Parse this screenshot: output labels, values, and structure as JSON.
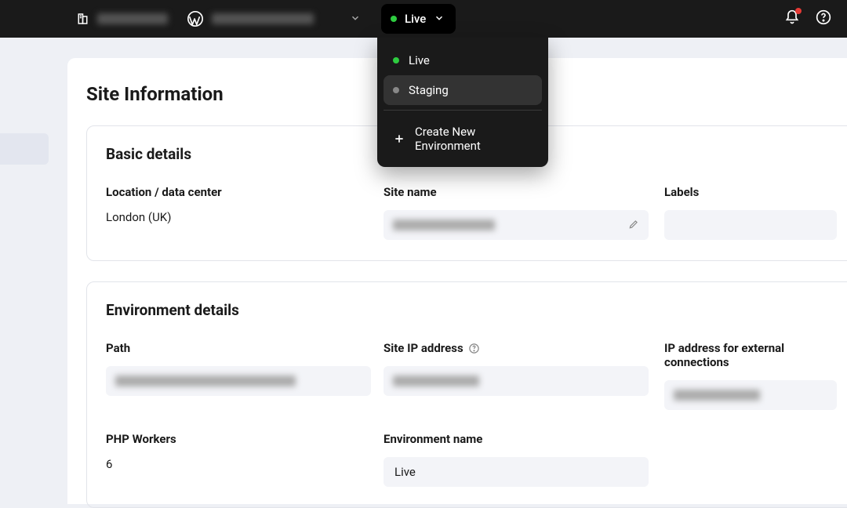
{
  "topbar": {
    "env_current": "Live",
    "dropdown": {
      "live": "Live",
      "staging": "Staging",
      "create": "Create New Environment"
    }
  },
  "page": {
    "title": "Site Information"
  },
  "basic": {
    "title": "Basic details",
    "location_label": "Location / data center",
    "location_value": "London (UK)",
    "sitename_label": "Site name",
    "labels_label": "Labels"
  },
  "env": {
    "title": "Environment details",
    "path_label": "Path",
    "siteip_label": "Site IP address",
    "extip_label": "IP address for external connections",
    "workers_label": "PHP Workers",
    "workers_value": "6",
    "envname_label": "Environment name",
    "envname_value": "Live"
  }
}
